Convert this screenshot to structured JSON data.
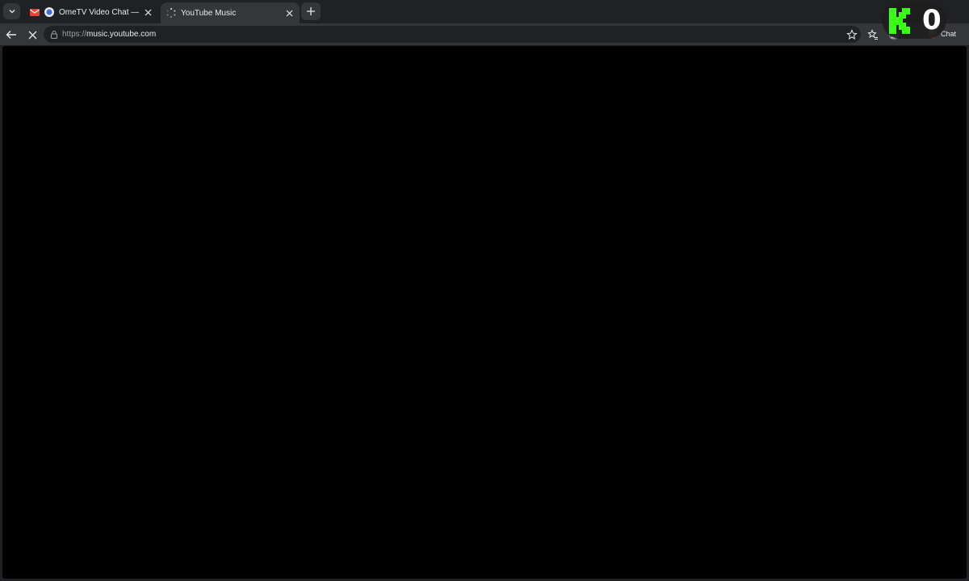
{
  "tabs": [
    {
      "title": "OmeTV Video Chat — Omegle",
      "active": false
    },
    {
      "title": "YouTube Music",
      "active": true,
      "loading": true
    }
  ],
  "omnibox": {
    "scheme": "https://",
    "host": "music.youtube.com"
  },
  "toolbar": {
    "chat_label": "Chat"
  },
  "overlay": {
    "digit": "0",
    "accent": "#39ff14"
  },
  "colors": {
    "frame": "#202124",
    "toolbar": "#35363a",
    "content": "#000000"
  }
}
